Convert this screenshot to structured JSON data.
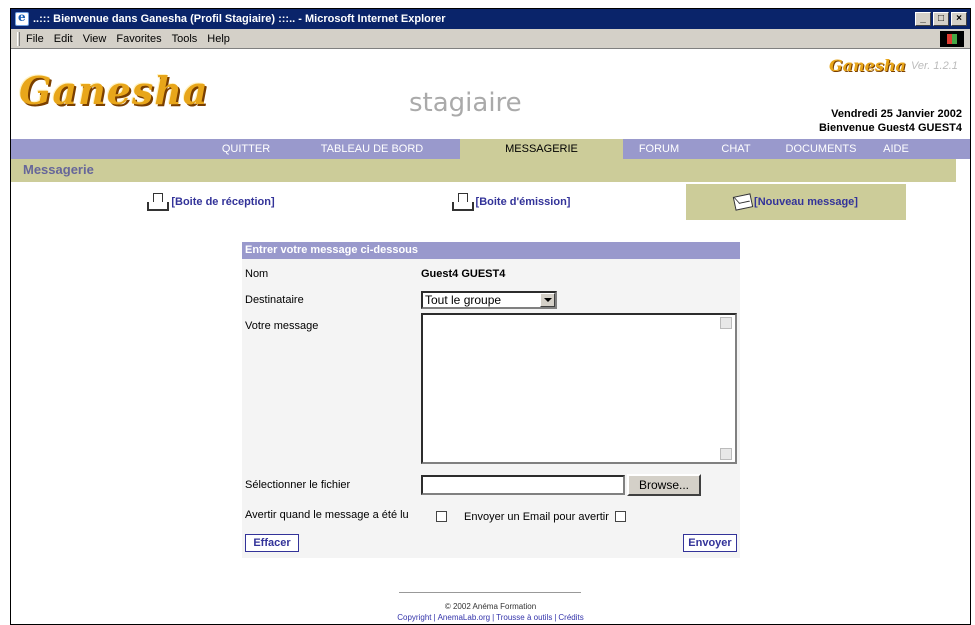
{
  "window": {
    "title": "..::: Bienvenue dans Ganesha (Profil Stagiaire) :::.. - Microsoft Internet Explorer",
    "controls": [
      "_",
      "□",
      "×"
    ]
  },
  "menubar": [
    "File",
    "Edit",
    "View",
    "Favorites",
    "Tools",
    "Help"
  ],
  "header": {
    "logo": "Ganesha",
    "profile": "stagiaire",
    "logo_small": "Ganesha",
    "version": "Ver. 1.2.1",
    "date": "Vendredi 25 Janvier 2002",
    "welcome": "Bienvenue Guest4 GUEST4"
  },
  "nav": {
    "items": [
      "QUITTER",
      "TABLEAU DE BORD",
      "MESSAGERIE",
      "FORUM",
      "CHAT",
      "DOCUMENTS",
      "AIDE"
    ],
    "active": "MESSAGERIE"
  },
  "section": {
    "title": "Messagerie"
  },
  "subtabs": {
    "inbox": "[Boite de réception]",
    "outbox": "[Boite d'émission]",
    "new": "[Nouveau message]"
  },
  "form": {
    "header": "Entrer votre message ci-dessous",
    "name_label": "Nom",
    "name_value": "Guest4 GUEST4",
    "recipient_label": "Destinataire",
    "recipient_value": "Tout le groupe",
    "message_label": "Votre message",
    "message_value": "",
    "file_label": "Sélectionner le fichier",
    "browse_label": "Browse...",
    "notify_read_label": "Avertir quand le message a été lu",
    "notify_email_label": "Envoyer un Email pour avertir",
    "clear_label": "Effacer",
    "send_label": "Envoyer"
  },
  "footer": {
    "copyright": "© 2002 Anéma Formation",
    "links": [
      "Copyright",
      "AnemaLab.org",
      "Trousse à outils",
      "Crédits"
    ],
    "separator": "|"
  },
  "colors": {
    "nav_bg": "#9999cc",
    "active_bg": "#cccc99",
    "link": "#333399",
    "title_bar": "#0a246a",
    "logo": "#e8a61a"
  }
}
